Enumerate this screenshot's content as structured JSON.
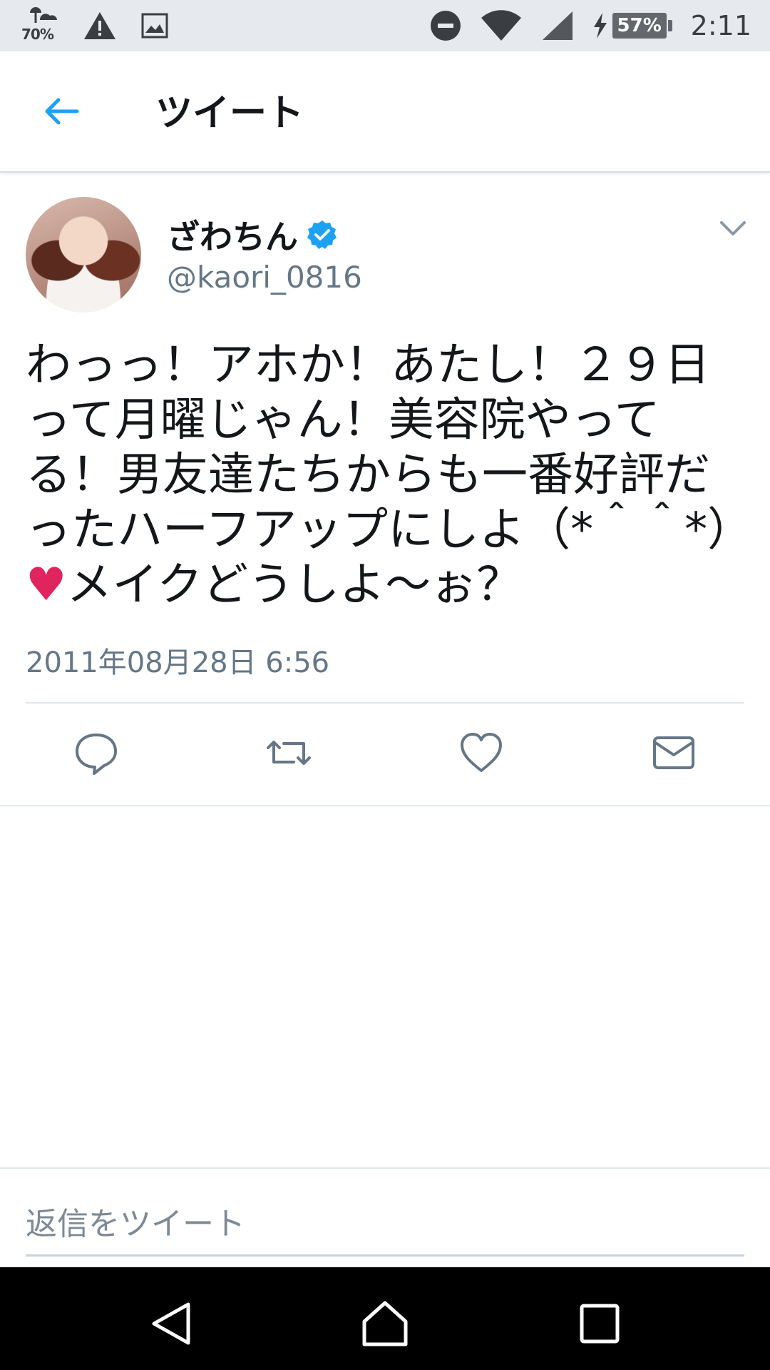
{
  "status_bar": {
    "weather_percent": "70%",
    "battery_percent": "57%",
    "time": "2:11",
    "icons": [
      "weather-icon",
      "warning-icon",
      "image-icon",
      "dnd-icon",
      "wifi-icon",
      "signal-icon",
      "charging-icon",
      "battery-icon"
    ]
  },
  "header": {
    "title": "ツイート",
    "back_icon": "back-arrow-icon"
  },
  "tweet": {
    "author_name": "ざわちん",
    "verified": true,
    "handle": "@kaori_0816",
    "text": "わっっ！アホか！あたし！２９日って月曜じゃん！美容院やってる！男友達たちからも一番好評だったハーフアップにしよ（*＾＾*）♥メイクどうしよ〜ぉ？",
    "timestamp": "2011年08月28日 6:56",
    "actions": [
      "reply-icon",
      "retweet-icon",
      "like-icon",
      "direct-message-icon"
    ]
  },
  "reply": {
    "placeholder": "返信をツイート"
  },
  "colors": {
    "accent": "#1da1f2",
    "secondary_text": "#657786",
    "heart": "#e0245e"
  }
}
